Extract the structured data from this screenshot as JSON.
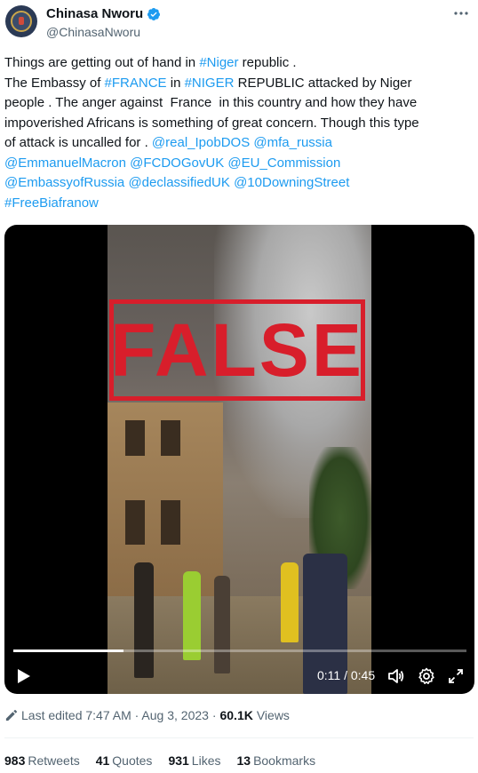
{
  "author": {
    "display_name": "Chinasa Nworu",
    "handle": "@ChinasaNworu",
    "verified": true
  },
  "more_icon": "more-horizontal-icon",
  "tweet": {
    "lines": [
      [
        {
          "t": "Things are getting out of hand in ",
          "link": false
        },
        {
          "t": "#Niger",
          "link": true
        },
        {
          "t": " republic .",
          "link": false
        }
      ],
      [
        {
          "t": "The Embassy of ",
          "link": false
        },
        {
          "t": "#FRANCE",
          "link": true
        },
        {
          "t": " in ",
          "link": false
        },
        {
          "t": "#NIGER",
          "link": true
        },
        {
          "t": " REPUBLIC attacked by Niger",
          "link": false
        }
      ],
      [
        {
          "t": "people . The anger against  France  in this country and how they have",
          "link": false
        }
      ],
      [
        {
          "t": "impoverished Africans is something of great concern. Though this type",
          "link": false
        }
      ],
      [
        {
          "t": "of attack is uncalled for . ",
          "link": false
        },
        {
          "t": "@real_IpobDOS",
          "link": true
        },
        {
          "t": " ",
          "link": false
        },
        {
          "t": "@mfa_russia",
          "link": true
        }
      ],
      [
        {
          "t": "@EmmanuelMacron",
          "link": true
        },
        {
          "t": " ",
          "link": false
        },
        {
          "t": "@FCDOGovUK",
          "link": true
        },
        {
          "t": " ",
          "link": false
        },
        {
          "t": "@EU_Commission",
          "link": true
        }
      ],
      [
        {
          "t": "@EmbassyofRussia",
          "link": true
        },
        {
          "t": " ",
          "link": false
        },
        {
          "t": "@declassifiedUK",
          "link": true
        },
        {
          "t": " ",
          "link": false
        },
        {
          "t": "@10DowningStreet",
          "link": true
        }
      ],
      [
        {
          "t": "#FreeBiafranow",
          "link": true
        }
      ]
    ]
  },
  "video": {
    "overlay_stamp": "FALSE",
    "current_time": "0:11",
    "duration": "0:45",
    "time_display": "0:11 / 0:45",
    "progress_fraction": 0.244,
    "controls": [
      "play-icon",
      "volume-icon",
      "settings-gear-icon",
      "fullscreen-icon"
    ]
  },
  "meta": {
    "edited_label": "Last edited 7:47 AM · Aug 3, 2023 · ",
    "views_count": "60.1K",
    "views_label": " Views"
  },
  "stats": [
    {
      "count": "983",
      "label": "Retweets"
    },
    {
      "count": "41",
      "label": "Quotes"
    },
    {
      "count": "931",
      "label": "Likes"
    },
    {
      "count": "13",
      "label": "Bookmarks"
    }
  ],
  "colors": {
    "link": "#1d9bf0",
    "text": "#0f1419",
    "secondary": "#536471",
    "stamp_red": "#d81e2b"
  }
}
